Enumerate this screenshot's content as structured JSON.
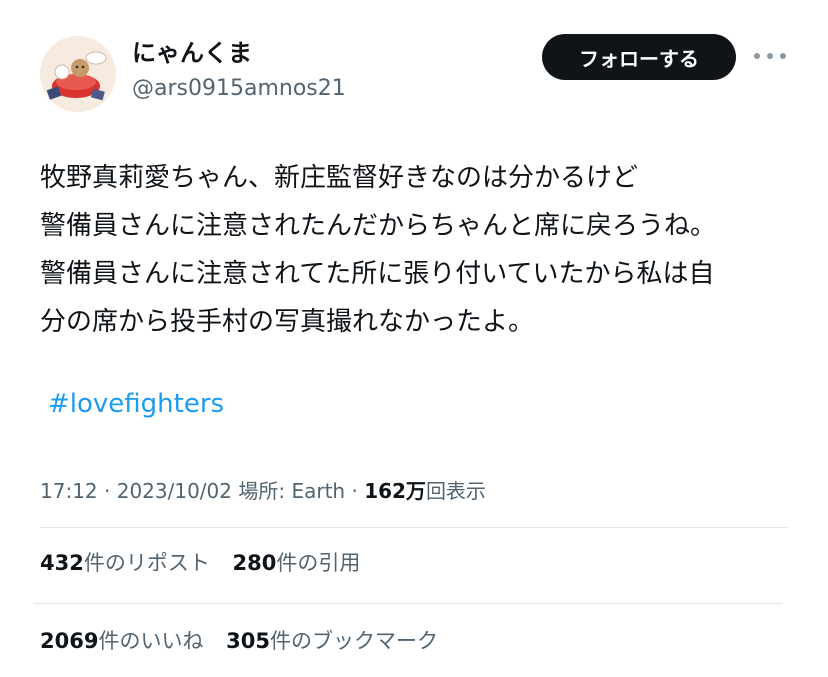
{
  "user": {
    "display_name": "にゃんくま",
    "handle": "@ars0915amnos21",
    "follow_label": "フォローする"
  },
  "tweet": {
    "lines": [
      "牧野真莉愛ちゃん、新庄監督好きなのは分かるけど",
      "警備員さんに注意されたんだからちゃんと席に戻ろうね。",
      "警備員さんに注意されてた所に張り付いていたから私は自",
      "分の席から投手村の写真撮れなかったよ。"
    ],
    "hashtag": "#lovefighters"
  },
  "meta": {
    "time": "17:12",
    "date": "2023/10/02",
    "location_label": "場所:",
    "location": "Earth",
    "views_count": "162万",
    "views_label": "回表示",
    "separator": "·"
  },
  "stats": {
    "reposts_count": "432",
    "reposts_label": "件のリポスト",
    "quotes_count": "280",
    "quotes_label": "件の引用",
    "likes_count": "2069",
    "likes_label": "件のいいね",
    "bookmarks_count": "305",
    "bookmarks_label": "件のブックマーク"
  },
  "icons": [
    "avatar-image",
    "more-options-icon"
  ],
  "colors": {
    "link": "#1d9bf0",
    "follow_bg": "#0f1419",
    "secondary_text": "#536471"
  }
}
